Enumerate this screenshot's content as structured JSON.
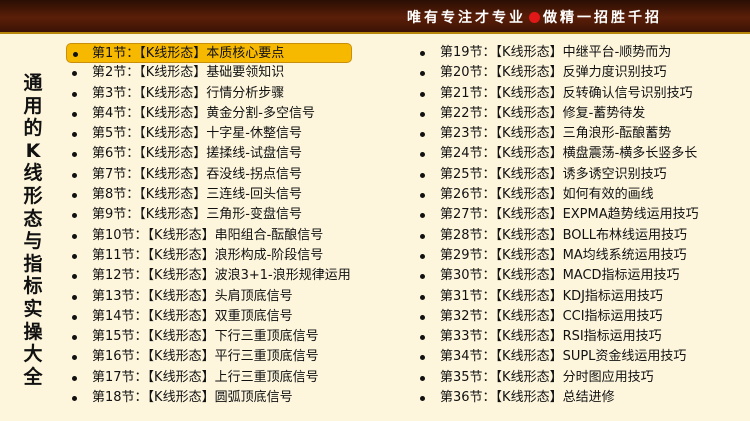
{
  "header": {
    "slogan_part1": "唯有专注才专业",
    "slogan_part2": "做精一招胜千招"
  },
  "side_title": "通用的K线形态与指标实操大全",
  "left_items": [
    "第1节：【K线形态】本质核心要点",
    "第2节：【K线形态】基础要领知识",
    "第3节：【K线形态】行情分析步骤",
    "第4节：【K线形态】黄金分割-多空信号",
    "第5节：【K线形态】十字星-休整信号",
    "第6节：【K线形态】搓揉线-试盘信号",
    "第7节：【K线形态】吞没线-拐点信号",
    "第8节：【K线形态】三连线-回头信号",
    "第9节：【K线形态】三角形-变盘信号",
    "第10节：【K线形态】串阳组合-酝酿信号",
    "第11节：【K线形态】浪形构成-阶段信号",
    "第12节：【K线形态】波浪3+1-浪形规律运用",
    "第13节：【K线形态】头肩顶底信号",
    "第14节：【K线形态】双重顶底信号",
    "第15节：【K线形态】下行三重顶底信号",
    "第16节：【K线形态】平行三重顶底信号",
    "第17节：【K线形态】上行三重顶底信号",
    "第18节：【K线形态】圆弧顶底信号"
  ],
  "right_items": [
    "第19节：【K线形态】中继平台-顺势而为",
    "第20节：【K线形态】反弹力度识别技巧",
    "第21节：【K线形态】反转确认信号识别技巧",
    "第22节：【K线形态】修复-蓄势待发",
    "第23节：【K线形态】三角浪形-酝酿蓄势",
    "第24节：【K线形态】横盘震荡-横多长竖多长",
    "第25节：【K线形态】诱多诱空识别技巧",
    "第26节：【K线形态】如何有效的画线",
    "第27节：【K线形态】EXPMA趋势线运用技巧",
    "第28节：【K线形态】BOLL布林线运用技巧",
    "第29节：【K线形态】MA均线系统运用技巧",
    "第30节：【K线形态】MACD指标运用技巧",
    "第31节：【K线形态】KDJ指标运用技巧",
    "第32节：【K线形态】CCI指标运用技巧",
    "第33节：【K线形态】RSI指标运用技巧",
    "第34节：【K线形态】SUPL资金线运用技巧",
    "第35节：【K线形态】分时图应用技巧",
    "第36节：【K线形态】总结进修"
  ],
  "colors": {
    "background": "#fdf6dd",
    "header": "#4a1a06",
    "highlight": "#f7b800",
    "slogan_dot": "#e01818"
  }
}
